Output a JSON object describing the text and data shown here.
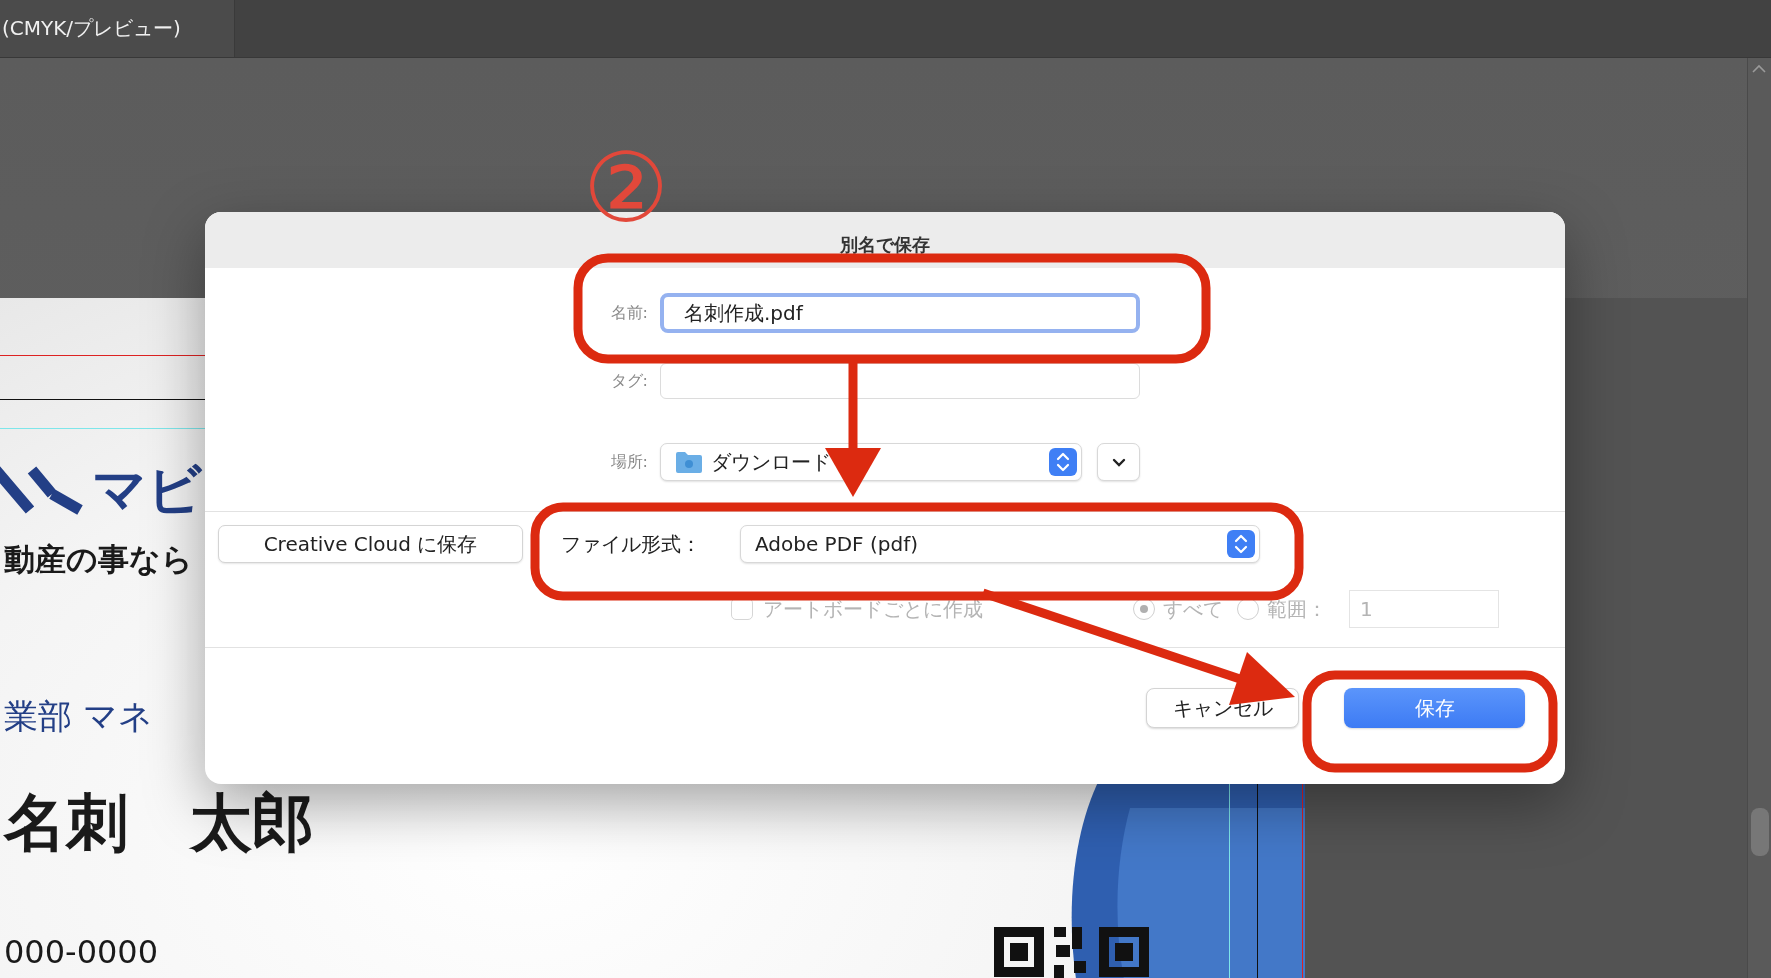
{
  "document_tab": {
    "title": "(CMYK/プレビュー)"
  },
  "artboard": {
    "texts": [
      {
        "kind": "logo",
        "text": "マビ"
      },
      {
        "kind": "tagline",
        "text": "動産の事なら"
      },
      {
        "kind": "department",
        "text": "業部 マネ"
      },
      {
        "kind": "person",
        "text": "名刺　太郎"
      },
      {
        "kind": "phone",
        "text": "000-0000"
      }
    ]
  },
  "dialog": {
    "title": "別名で保存",
    "name": {
      "label": "名前:",
      "value": "名刺作成.pdf",
      "focused": true
    },
    "tags": {
      "label": "タグ:"
    },
    "location": {
      "label": "場所:",
      "value": "ダウンロード"
    },
    "creative_cloud_button": "Creative Cloud に保存",
    "format": {
      "label": "ファイル形式：",
      "value": "Adobe PDF (pdf)"
    },
    "options": {
      "disabled": true,
      "checkbox": {
        "label": "アートボードごとに作成",
        "checked": false
      },
      "radios": [
        {
          "label": "すべて",
          "selected": true
        },
        {
          "label": "範囲：",
          "selected": false
        }
      ],
      "range_value": "1"
    },
    "buttons": [
      {
        "kind": "secondary",
        "label": "キャンセル"
      },
      {
        "kind": "primary",
        "label": "保存"
      }
    ]
  },
  "annotations": {
    "step_label": "②"
  }
}
